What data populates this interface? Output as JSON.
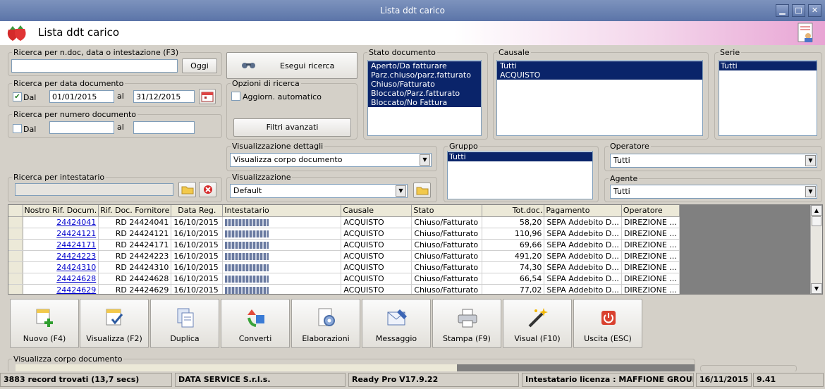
{
  "window": {
    "title": "Lista ddt carico"
  },
  "header": {
    "title": "Lista ddt carico"
  },
  "search_text": {
    "legend": "Ricerca per n.doc, data o intestazione (F3)",
    "value": "",
    "today_label": "Oggi"
  },
  "search_button": {
    "label": "Esegui ricerca"
  },
  "date_search": {
    "legend": "Ricerca per data documento",
    "from_label": "Dal",
    "from_checked": true,
    "from": "01/01/2015",
    "to_label": "al",
    "to": "31/12/2015"
  },
  "number_search": {
    "legend": "Ricerca per numero documento",
    "from_label": "Dal",
    "from_checked": false,
    "from": "",
    "to_label": "al",
    "to": ""
  },
  "search_options": {
    "legend": "Opzioni di ricerca",
    "auto_update_label": "Aggiorn. automatico",
    "advanced_filters_label": "Filtri avanzati"
  },
  "doc_status": {
    "legend": "Stato documento",
    "items": [
      "Aperto/Da fatturare",
      "Parz.chiuso/parz.fatturato",
      "Chiuso/Fatturato",
      "Bloccato/Parz.fatturato",
      "Bloccato/No Fattura"
    ]
  },
  "causale": {
    "legend": "Causale",
    "items": [
      "Tutti",
      "ACQUISTO"
    ]
  },
  "serie": {
    "legend": "Serie",
    "items": [
      "Tutti"
    ]
  },
  "details_view": {
    "legend": "Visualizzazione dettagli",
    "value": "Visualizza corpo documento"
  },
  "view": {
    "legend": "Visualizzazione",
    "value": "Default"
  },
  "group": {
    "legend": "Gruppo",
    "items": [
      "Tutti"
    ]
  },
  "operator": {
    "legend": "Operatore",
    "value": "Tutti"
  },
  "agent": {
    "legend": "Agente",
    "value": "Tutti"
  },
  "holder_search": {
    "legend": "Ricerca per intestatario",
    "value": ""
  },
  "grid": {
    "columns": [
      "Nostro Rif. Docum.",
      "Rif. Doc. Fornitore",
      "Data Reg.",
      "Intestatario",
      "Causale",
      "Stato",
      "Tot.doc.",
      "Pagamento",
      "Operatore"
    ],
    "rows": [
      [
        "24424041",
        "RD 24424041",
        "16/10/2015",
        "",
        "ACQUISTO",
        "Chiuso/Fatturato",
        "58,20",
        "SEPA Addebito D...",
        "DIREZIONE ..."
      ],
      [
        "24424121",
        "RD 24424121",
        "16/10/2015",
        "",
        "ACQUISTO",
        "Chiuso/Fatturato",
        "110,96",
        "SEPA Addebito D...",
        "DIREZIONE ..."
      ],
      [
        "24424171",
        "RD 24424171",
        "16/10/2015",
        "",
        "ACQUISTO",
        "Chiuso/Fatturato",
        "69,66",
        "SEPA Addebito D...",
        "DIREZIONE ..."
      ],
      [
        "24424223",
        "RD 24424223",
        "16/10/2015",
        "",
        "ACQUISTO",
        "Chiuso/Fatturato",
        "491,20",
        "SEPA Addebito D...",
        "DIREZIONE ..."
      ],
      [
        "24424310",
        "RD 24424310",
        "16/10/2015",
        "",
        "ACQUISTO",
        "Chiuso/Fatturato",
        "74,30",
        "SEPA Addebito D...",
        "DIREZIONE ..."
      ],
      [
        "24424628",
        "RD 24424628",
        "16/10/2015",
        "",
        "ACQUISTO",
        "Chiuso/Fatturato",
        "66,54",
        "SEPA Addebito D...",
        "DIREZIONE ..."
      ],
      [
        "24424629",
        "RD 24424629",
        "16/10/2015",
        "",
        "ACQUISTO",
        "Chiuso/Fatturato",
        "77,02",
        "SEPA Addebito D...",
        "DIREZIONE ..."
      ]
    ]
  },
  "toolbar": [
    {
      "label": "Nuovo (F4)",
      "icon": "new-document-icon"
    },
    {
      "label": "Visualizza (F2)",
      "icon": "view-document-icon"
    },
    {
      "label": "Duplica",
      "icon": "duplicate-icon"
    },
    {
      "label": "Converti",
      "icon": "convert-icon"
    },
    {
      "label": "Elaborazioni",
      "icon": "process-icon"
    },
    {
      "label": "Messaggio",
      "icon": "message-icon"
    },
    {
      "label": "Stampa (F9)",
      "icon": "print-icon"
    },
    {
      "label": "Visual (F10)",
      "icon": "magic-wand-icon"
    },
    {
      "label": "Uscita (ESC)",
      "icon": "exit-icon"
    }
  ],
  "body_view": {
    "legend": "Visualizza corpo documento"
  },
  "status": {
    "records": "3883 record trovati (13,7 secs)",
    "company": "DATA SERVICE S.r.l.s.",
    "product": "Ready Pro V17.9.22",
    "license": "Intestatario licenza : MAFFIONE GROUP DI M",
    "date": "16/11/2015",
    "version": "9.41"
  },
  "colors": {
    "title_bar": "#6b82b3",
    "selection": "#0a246a",
    "link": "#0000cc",
    "header_pink": "#e8a4d4"
  }
}
